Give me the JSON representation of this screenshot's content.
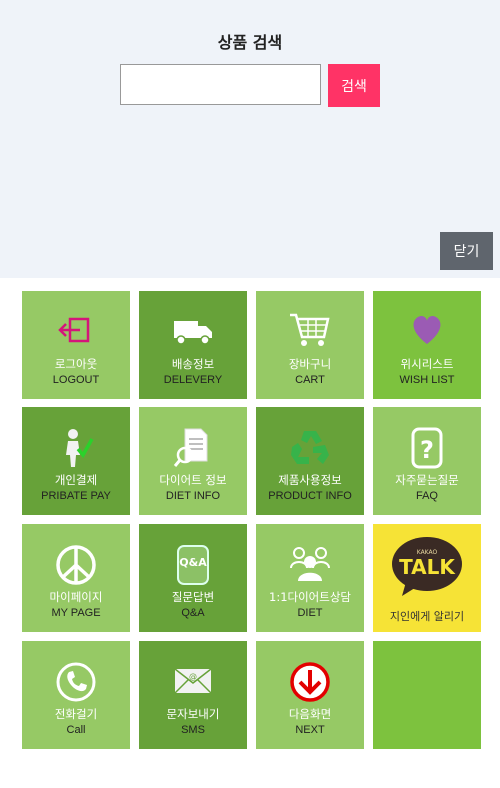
{
  "search": {
    "title": "상품 검색",
    "input_value": "",
    "button_label": "검색"
  },
  "close_label": "닫기",
  "colors": {
    "tile_light": "#96c965",
    "tile_dark": "#67a239",
    "accent": "#ff3366",
    "talk": "#f6e336"
  },
  "tiles": [
    {
      "label": "로그아웃",
      "sub": "LOGOUT",
      "icon": "logout-icon"
    },
    {
      "label": "배송정보",
      "sub": "DELEVERY",
      "icon": "truck-icon"
    },
    {
      "label": "장바구니",
      "sub": "CART",
      "icon": "cart-icon"
    },
    {
      "label": "위시리스트",
      "sub": "WISH LIST",
      "icon": "heart-icon"
    },
    {
      "label": "개인결제",
      "sub": "PRIBATE PAY",
      "icon": "person-check-icon"
    },
    {
      "label": "다이어트 정보",
      "sub": "DIET INFO",
      "icon": "document-search-icon"
    },
    {
      "label": "제품사용정보",
      "sub": "PRODUCT INFO",
      "icon": "recycle-icon"
    },
    {
      "label": "자주묻는질문",
      "sub": "FAQ",
      "icon": "question-icon"
    },
    {
      "label": "마이페이지",
      "sub": "MY PAGE",
      "icon": "peace-icon"
    },
    {
      "label": "질문답변",
      "sub": "Q&A",
      "icon": "qa-icon",
      "icon_text": "Q&A"
    },
    {
      "label": "1:1다이어트상담",
      "sub": "DIET",
      "icon": "group-icon"
    },
    {
      "label": "지인에게 알리기",
      "icon": "kakao-talk-icon",
      "icon_small": "KAKAO",
      "icon_text": "TALK"
    },
    {
      "label": "전화걸기",
      "sub": "Call",
      "icon": "phone-icon"
    },
    {
      "label": "문자보내기",
      "sub": "SMS",
      "icon": "mail-icon"
    },
    {
      "label": "다음화면",
      "sub": "NEXT",
      "icon": "arrow-down-icon"
    },
    {
      "label": "",
      "icon": ""
    }
  ]
}
